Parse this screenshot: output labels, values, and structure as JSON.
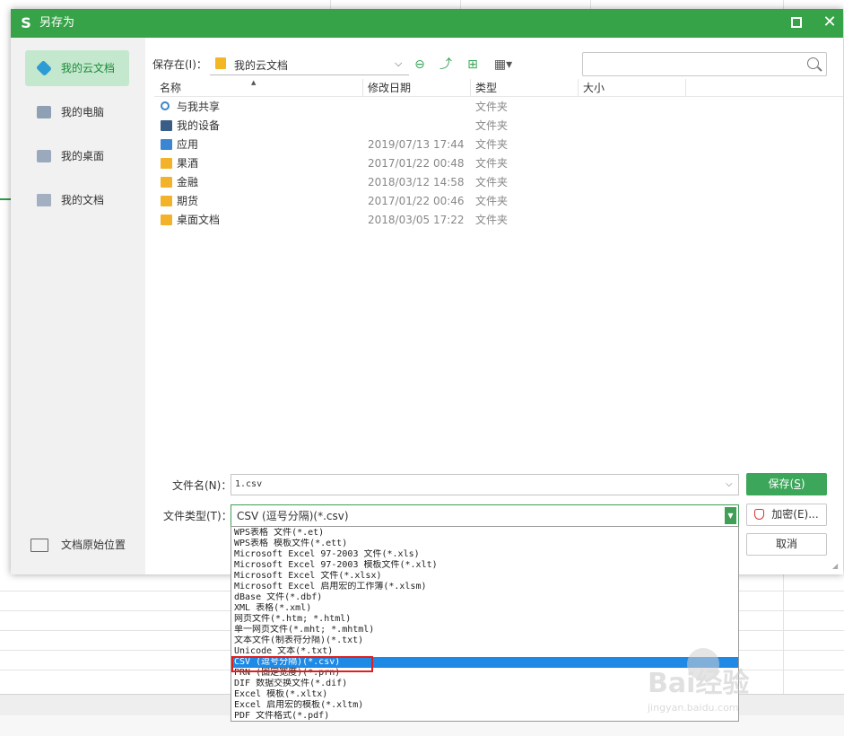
{
  "dialog": {
    "title": "另存为",
    "logo": "S"
  },
  "sidebar": {
    "items": [
      {
        "label": "我的云文档",
        "icon": "cloud-docs-icon",
        "active": true
      },
      {
        "label": "我的电脑",
        "icon": "computer-icon"
      },
      {
        "label": "我的桌面",
        "icon": "desktop-icon"
      },
      {
        "label": "我的文档",
        "icon": "documents-icon"
      }
    ],
    "original_location": "文档原始位置"
  },
  "toolbar": {
    "save_in_label": "保存在(I)：",
    "save_in_value": "我的云文档",
    "search_placeholder": ""
  },
  "file_list": {
    "columns": [
      "名称",
      "修改日期",
      "类型",
      "大小"
    ],
    "rows": [
      {
        "name": "与我共享",
        "date": "",
        "type": "文件夹",
        "icon": "share-icon"
      },
      {
        "name": "我的设备",
        "date": "",
        "type": "文件夹",
        "icon": "device-icon"
      },
      {
        "name": "应用",
        "date": "2019/07/13 17:44",
        "type": "文件夹",
        "icon": "app-folder-icon"
      },
      {
        "name": "果酒",
        "date": "2017/01/22 00:48",
        "type": "文件夹",
        "icon": "folder-icon"
      },
      {
        "name": "金融",
        "date": "2018/03/12 14:58",
        "type": "文件夹",
        "icon": "folder-icon"
      },
      {
        "name": "期货",
        "date": "2017/01/22 00:46",
        "type": "文件夹",
        "icon": "folder-icon"
      },
      {
        "name": "桌面文档",
        "date": "2018/03/05 17:22",
        "type": "文件夹",
        "icon": "folder-icon"
      }
    ]
  },
  "form": {
    "filename_label": "文件名(N)：",
    "filename_value": "1.csv",
    "filetype_label": "文件类型(T)：",
    "filetype_value": "CSV (逗号分隔)(*.csv)"
  },
  "buttons": {
    "save": "保存(",
    "save_key": "S",
    "save_end": ")",
    "encrypt": "加密(E)...",
    "cancel": "取消"
  },
  "filetype_options": [
    "WPS表格 文件(*.et)",
    "WPS表格 模板文件(*.ett)",
    "Microsoft Excel 97-2003 文件(*.xls)",
    "Microsoft Excel 97-2003 模板文件(*.xlt)",
    "Microsoft Excel 文件(*.xlsx)",
    "Microsoft Excel 启用宏的工作簿(*.xlsm)",
    "dBase 文件(*.dbf)",
    "XML 表格(*.xml)",
    "网页文件(*.htm; *.html)",
    "单一网页文件(*.mht; *.mhtml)",
    "文本文件(制表符分隔)(*.txt)",
    "Unicode 文本(*.txt)",
    "CSV (逗号分隔)(*.csv)",
    "PRN (固定宽度)(*.prn)",
    "DIF 数据交换文件(*.dif)",
    "Excel 模板(*.xltx)",
    "Excel 启用宏的模板(*.xltm)",
    "PDF 文件格式(*.pdf)"
  ],
  "selected_option_index": 12,
  "watermark": {
    "brand": "Bai经验",
    "url": "jingyan.baidu.com"
  },
  "colors": {
    "accent": "#37a348",
    "selection": "#1e8ae6",
    "highlight": "#e02020"
  }
}
